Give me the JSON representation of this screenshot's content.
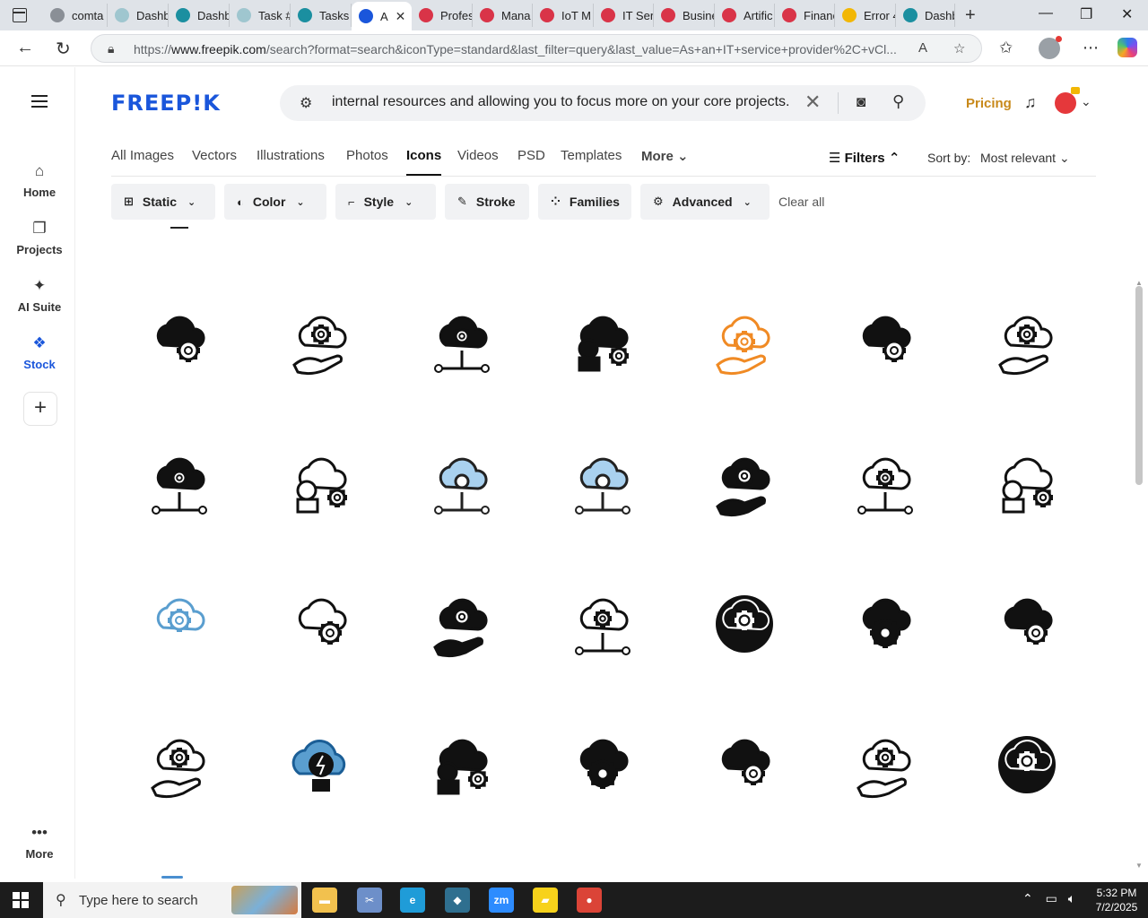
{
  "browser": {
    "tabs": [
      {
        "label": "comta",
        "favicon_color": "#8a8f96"
      },
      {
        "label": "Dashb",
        "favicon_color": "#9fc6cf"
      },
      {
        "label": "Dashb",
        "favicon_color": "#1b8fa0"
      },
      {
        "label": "Task #",
        "favicon_color": "#9fc6cf"
      },
      {
        "label": "Tasks",
        "favicon_color": "#1b8fa0"
      },
      {
        "label": "A",
        "favicon_color": "#1a56db",
        "active": true
      },
      {
        "label": "Profes",
        "favicon_color": "#d93448"
      },
      {
        "label": "Mana",
        "favicon_color": "#d93448"
      },
      {
        "label": "IoT M",
        "favicon_color": "#d93448"
      },
      {
        "label": "IT Ser",
        "favicon_color": "#d93448"
      },
      {
        "label": "Busine",
        "favicon_color": "#d93448"
      },
      {
        "label": "Artific",
        "favicon_color": "#d93448"
      },
      {
        "label": "Financ",
        "favicon_color": "#d93448"
      },
      {
        "label": "Error 4",
        "favicon_color": "#f2b705"
      },
      {
        "label": "Dashb",
        "favicon_color": "#1b8fa0"
      }
    ],
    "url_prefix": "https://",
    "url_domain": "www.freepik.com",
    "url_rest": "/search?format=search&iconType=standard&last_filter=query&last_value=As+an+IT+service+provider%2C+vCl..."
  },
  "sidebar": {
    "items": [
      {
        "label": "Home",
        "icon": "home-icon",
        "glyph": "⌂"
      },
      {
        "label": "Projects",
        "icon": "folder-icon",
        "glyph": "❐"
      },
      {
        "label": "AI Suite",
        "icon": "sparkle-icon",
        "glyph": "✦"
      },
      {
        "label": "Stock",
        "icon": "stock-icon",
        "glyph": "❖",
        "active": true
      }
    ],
    "add_label": "+",
    "more_label": "More",
    "more_glyph": "•••"
  },
  "header": {
    "logo": "FREEP!K",
    "search_value": "internal resources and allowing you to focus more on your core projects.",
    "pricing": "Pricing"
  },
  "categories": {
    "tabs": [
      "All Images",
      "Vectors",
      "Illustrations",
      "Photos",
      "Icons",
      "Videos",
      "PSD",
      "Templates",
      "More"
    ],
    "active": "Icons",
    "filters_label": "Filters",
    "sort_label": "Sort by:",
    "sort_value": "Most relevant"
  },
  "filter_chips": [
    {
      "label": "Static",
      "icon": "static-icon",
      "dropdown": true
    },
    {
      "label": "Color",
      "icon": "palette-icon",
      "dropdown": true
    },
    {
      "label": "Style",
      "icon": "brush-icon",
      "dropdown": true
    },
    {
      "label": "Stroke",
      "icon": "pen-icon",
      "dropdown": false
    },
    {
      "label": "Families",
      "icon": "families-icon",
      "dropdown": false
    },
    {
      "label": "Advanced",
      "icon": "gear-icon",
      "dropdown": true
    }
  ],
  "clear_all": "Clear all",
  "results": {
    "icons": [
      {
        "name": "person-cloud-gear-icon",
        "style": "black"
      },
      {
        "name": "cloud-gear-question-icon",
        "style": "outline"
      },
      {
        "name": "hand-gear-cloud-icon",
        "style": "black"
      },
      {
        "name": "people-cloud-network-icon",
        "style": "black"
      },
      {
        "name": "hand-cloud-gear-orange-icon",
        "style": "orange"
      },
      {
        "name": "person-laptop-cloud-icon",
        "style": "black"
      },
      {
        "name": "hand-cloud-gear-icon",
        "style": "outline"
      },
      {
        "name": "hand-gear-wifi-icon",
        "style": "black"
      },
      {
        "name": "hands-gear-tools-icon",
        "style": "outline"
      },
      {
        "name": "cloud-network-blue-icon",
        "style": "blue"
      },
      {
        "name": "cloud-network-blue-2-icon",
        "style": "blue"
      },
      {
        "name": "hands-gear-tools-cloud-icon",
        "style": "black"
      },
      {
        "name": "cloud-robot-plug-icon",
        "style": "outline"
      },
      {
        "name": "cloud-wrench-network-icon",
        "style": "outline"
      },
      {
        "name": "cloud-gear-light-blue-icon",
        "style": "lightblue"
      },
      {
        "name": "hands-cloud-device-icon",
        "style": "outline"
      },
      {
        "name": "hands-cloud-upload-icon",
        "style": "black"
      },
      {
        "name": "cloud-wrench-outline-icon",
        "style": "outline"
      },
      {
        "name": "circle-cloud-gear-icon",
        "style": "circle"
      },
      {
        "name": "cloud-gear-rotate-icon",
        "style": "black"
      },
      {
        "name": "person-cloud-lock-icon",
        "style": "black"
      },
      {
        "name": "person-cloud-wifi-gear-icon",
        "style": "outline"
      },
      {
        "name": "cloud-bulb-blue-icon",
        "style": "bluefill"
      },
      {
        "name": "hand-cloud-circuit-icon",
        "style": "black"
      },
      {
        "name": "cloud-bulb-gear-icon",
        "style": "black"
      },
      {
        "name": "cloud-wrench-gear-icon",
        "style": "black"
      },
      {
        "name": "gear-cloud-outline-icon",
        "style": "outline"
      },
      {
        "name": "circle-cloud-download-icon",
        "style": "circle"
      }
    ]
  },
  "taskbar": {
    "search_placeholder": "Type here to search",
    "apps": [
      {
        "name": "file-explorer-icon",
        "color": "#f2c14e",
        "glyph": "▬"
      },
      {
        "name": "snipping-tool-icon",
        "color": "#6d8fc9",
        "glyph": "✂"
      },
      {
        "name": "edge-icon",
        "color": "#1f9cd8",
        "glyph": "e"
      },
      {
        "name": "app-blue-icon",
        "color": "#2f6f8f",
        "glyph": "◆"
      },
      {
        "name": "zoom-icon",
        "color": "#2d8cff",
        "glyph": "zm"
      },
      {
        "name": "sticky-notes-icon",
        "color": "#f7d21b",
        "glyph": "▰"
      },
      {
        "name": "chrome-icon",
        "color": "#db4437",
        "glyph": "●"
      }
    ],
    "time": "5:32 PM",
    "date": "7/2/2025"
  },
  "colors": {
    "brand_blue": "#1a56db",
    "pricing_gold": "#c8891a",
    "orange_icon": "#f08a24",
    "blue_icon": "#a9d1ef",
    "light_blue_icon": "#5a9ecf"
  }
}
